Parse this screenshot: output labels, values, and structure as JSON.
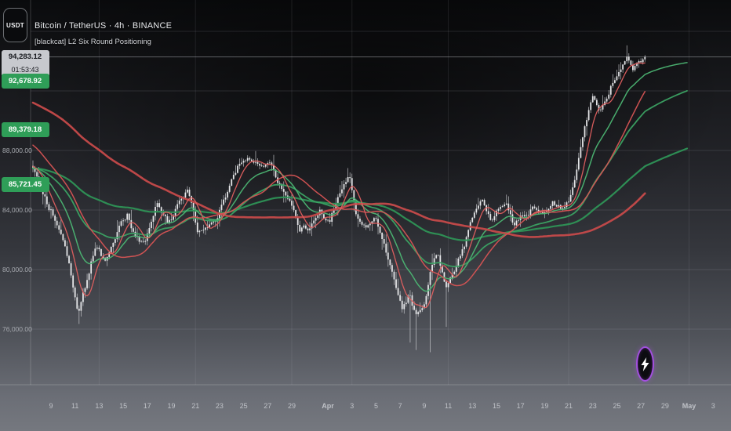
{
  "legend": {
    "symbol_title": "Bitcoin / TetherUS · 4h · BINANCE",
    "indicator_title": "[blackcat] L2 Six Round Positioning"
  },
  "price_scale": {
    "currency_button_label": "USDT",
    "ticks": [
      {
        "label": "88,000.00",
        "value": 88000
      },
      {
        "label": "84,000.00",
        "value": 84000
      },
      {
        "label": "80,000.00",
        "value": 80000
      },
      {
        "label": "76,000.00",
        "value": 76000
      }
    ]
  },
  "last_price": {
    "label": "94,283.12",
    "value": 94283.12,
    "countdown": "01:53:43"
  },
  "ma_value_labels": [
    {
      "label": "92,678.92",
      "value": 92678.92,
      "color": "#2f9e58"
    },
    {
      "label": "89,379.18",
      "value": 89379.18,
      "color": "#2f9e58"
    },
    {
      "label": "85,721.45",
      "value": 85721.45,
      "color": "#2f9e58"
    }
  ],
  "time_axis": {
    "ticks": [
      {
        "label": "9",
        "t": 0
      },
      {
        "label": "11",
        "t": 2
      },
      {
        "label": "13",
        "t": 4
      },
      {
        "label": "15",
        "t": 6
      },
      {
        "label": "17",
        "t": 8
      },
      {
        "label": "19",
        "t": 10
      },
      {
        "label": "21",
        "t": 12
      },
      {
        "label": "23",
        "t": 14
      },
      {
        "label": "25",
        "t": 16
      },
      {
        "label": "27",
        "t": 18
      },
      {
        "label": "29",
        "t": 20
      },
      {
        "label": "Apr",
        "t": 23,
        "strong": true
      },
      {
        "label": "3",
        "t": 25
      },
      {
        "label": "5",
        "t": 27
      },
      {
        "label": "7",
        "t": 29
      },
      {
        "label": "9",
        "t": 31
      },
      {
        "label": "11",
        "t": 33
      },
      {
        "label": "13",
        "t": 35
      },
      {
        "label": "15",
        "t": 37
      },
      {
        "label": "17",
        "t": 39
      },
      {
        "label": "19",
        "t": 41
      },
      {
        "label": "21",
        "t": 43
      },
      {
        "label": "23",
        "t": 45
      },
      {
        "label": "25",
        "t": 47
      },
      {
        "label": "27",
        "t": 49
      },
      {
        "label": "29",
        "t": 51
      },
      {
        "label": "May",
        "t": 53,
        "strong": true
      },
      {
        "label": "3",
        "t": 55
      }
    ]
  },
  "boost_button": {
    "icon": "lightning-bolt",
    "ring_color": "#a34fe0"
  },
  "chart_data": {
    "type": "candlestick",
    "symbol": "BTCUSDT",
    "exchange": "BINANCE",
    "interval": "4h",
    "title": "Bitcoin / TetherUS · 4h · BINANCE",
    "last_price": 94283.12,
    "candle_color": "#e9eaec",
    "wick_color": "#d6d7da",
    "y_axis": {
      "tick_prices": [
        88000,
        84000,
        80000,
        76000
      ],
      "gridline_prices": [
        96000,
        92000,
        88000,
        84000,
        80000,
        76000
      ],
      "approx_visible_range": [
        71800,
        97600
      ]
    },
    "x_axis": {
      "t_unit": "days_since_Mar_9_00:00",
      "gridline_ts": [
        4,
        12,
        20,
        25,
        33,
        43,
        53
      ]
    },
    "candles_per_day": 6,
    "history_t_start": -26,
    "visible_t_start": -1.63,
    "t_end": 49.45,
    "history_path": [
      [
        -26,
        96200
      ],
      [
        -24,
        94500
      ],
      [
        -22,
        95200
      ],
      [
        -20,
        92800
      ],
      [
        -18.5,
        94600
      ],
      [
        -17,
        91800
      ],
      [
        -15.5,
        93500
      ],
      [
        -14,
        92000
      ],
      [
        -12.5,
        93200
      ],
      [
        -11,
        90500
      ],
      [
        -9.5,
        92000
      ],
      [
        -8,
        90000
      ],
      [
        -6.5,
        91000
      ],
      [
        -5,
        88000
      ],
      [
        -3.5,
        87600
      ],
      [
        -2,
        86900
      ]
    ],
    "price_path": [
      [
        -1.63,
        86900
      ],
      [
        -1.11,
        85950
      ],
      [
        -0.33,
        84530
      ],
      [
        0.65,
        82680
      ],
      [
        1.5,
        80580
      ],
      [
        2.28,
        77000
      ],
      [
        3.06,
        79530
      ],
      [
        3.71,
        81630
      ],
      [
        4.56,
        80580
      ],
      [
        5.54,
        82680
      ],
      [
        6.32,
        83740
      ],
      [
        6.97,
        82160
      ],
      [
        7.82,
        81630
      ],
      [
        8.79,
        84530
      ],
      [
        9.77,
        82950
      ],
      [
        10.62,
        84530
      ],
      [
        11.4,
        85320
      ],
      [
        12.18,
        82680
      ],
      [
        13.03,
        82950
      ],
      [
        13.88,
        83630
      ],
      [
        14.66,
        85320
      ],
      [
        15.44,
        86890
      ],
      [
        16.29,
        87420
      ],
      [
        16.94,
        87160
      ],
      [
        17.59,
        86890
      ],
      [
        18.24,
        87160
      ],
      [
        19.09,
        85580
      ],
      [
        19.87,
        84530
      ],
      [
        20.65,
        82680
      ],
      [
        21.5,
        82950
      ],
      [
        22.35,
        84000
      ],
      [
        23.13,
        83210
      ],
      [
        23.91,
        85050
      ],
      [
        24.76,
        86370
      ],
      [
        25.41,
        83470
      ],
      [
        26.25,
        82680
      ],
      [
        26.91,
        83630
      ],
      [
        27.69,
        81630
      ],
      [
        28.34,
        79790
      ],
      [
        29.12,
        77420
      ],
      [
        29.77,
        78470
      ],
      [
        30.29,
        76890
      ],
      [
        31.07,
        77950
      ],
      [
        31.73,
        80580
      ],
      [
        32.12,
        81100
      ],
      [
        32.77,
        78740
      ],
      [
        33.55,
        80050
      ],
      [
        34.33,
        81630
      ],
      [
        35.18,
        83740
      ],
      [
        35.83,
        84790
      ],
      [
        36.48,
        83210
      ],
      [
        37.13,
        84000
      ],
      [
        37.79,
        84370
      ],
      [
        38.44,
        82950
      ],
      [
        39.28,
        83740
      ],
      [
        40.07,
        84160
      ],
      [
        40.85,
        83840
      ],
      [
        41.69,
        84370
      ],
      [
        42.54,
        84000
      ],
      [
        43.19,
        84890
      ],
      [
        43.84,
        87680
      ],
      [
        44.5,
        90050
      ],
      [
        45.02,
        91630
      ],
      [
        45.54,
        90580
      ],
      [
        46.06,
        91370
      ],
      [
        46.58,
        92420
      ],
      [
        47.23,
        93210
      ],
      [
        47.88,
        94160
      ],
      [
        48.4,
        93470
      ],
      [
        48.86,
        93840
      ],
      [
        49.45,
        94283.12
      ]
    ],
    "wick_events": [
      {
        "t": 2.28,
        "low": 76350
      },
      {
        "t": 29.8,
        "low": 75100
      },
      {
        "t": 30.3,
        "low": 74600
      },
      {
        "t": 31.5,
        "low": 74450
      },
      {
        "t": 32.8,
        "low": 76150
      },
      {
        "t": 47.88,
        "high": 95060
      },
      {
        "t": 16.94,
        "high": 87960
      }
    ],
    "ma_lines": [
      {
        "name": "slow-red",
        "type": "sma",
        "period": 120,
        "color": "#c64a4a",
        "width": 2.6,
        "uses_history": true
      },
      {
        "name": "mid-red",
        "type": "sma",
        "period": 35,
        "color": "#d75454",
        "width": 1.5,
        "uses_history": true
      },
      {
        "name": "fast-red",
        "type": "sma",
        "period": 8,
        "color": "#e26060",
        "width": 1.3,
        "uses_history": true
      },
      {
        "name": "slow-green",
        "type": "ema",
        "period": 130,
        "color": "#2e9456",
        "width": 2.2,
        "uses_history": false,
        "end_label": "85,721.45"
      },
      {
        "name": "mid-green",
        "type": "ema",
        "period": 48,
        "color": "#3ba263",
        "width": 1.8,
        "uses_history": false,
        "end_label": "89,379.18"
      },
      {
        "name": "fast-green",
        "type": "ema",
        "period": 20,
        "color": "#4cb573",
        "width": 1.5,
        "uses_history": false,
        "end_label": "92,678.92"
      }
    ]
  }
}
